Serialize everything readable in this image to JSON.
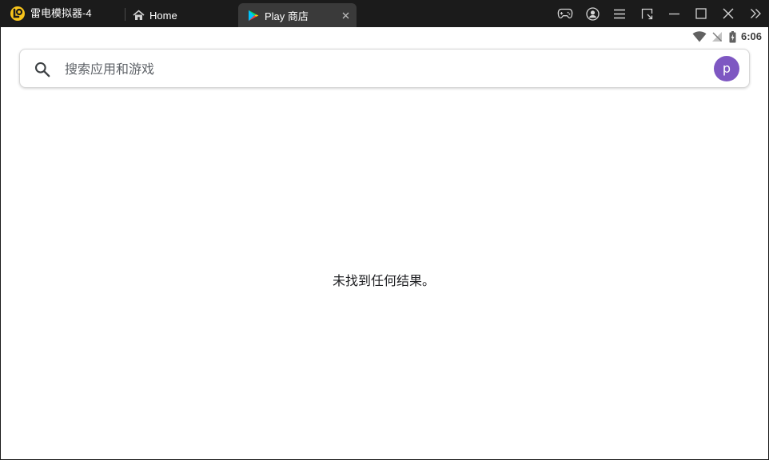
{
  "window": {
    "app_title": "雷电模拟器-4",
    "brand_color": "#f9c51b"
  },
  "tabs": [
    {
      "label": "Home",
      "icon": "home-icon"
    },
    {
      "label": "Play 商店",
      "icon": "play-store-icon",
      "active": true
    }
  ],
  "window_controls": [
    "gamepad-icon",
    "account-icon",
    "menu-icon",
    "resize-icon",
    "minimize-icon",
    "maximize-icon",
    "close-icon",
    "expand-sidebar-icon"
  ],
  "status_bar": {
    "icons": [
      "wifi-icon",
      "no-signal-icon",
      "battery-charging-icon"
    ],
    "time": "6:06"
  },
  "search": {
    "placeholder": "搜索应用和游戏",
    "value": ""
  },
  "account": {
    "avatar_letter": "p",
    "avatar_color": "#7e57c2"
  },
  "main": {
    "empty_message": "未找到任何结果。"
  }
}
